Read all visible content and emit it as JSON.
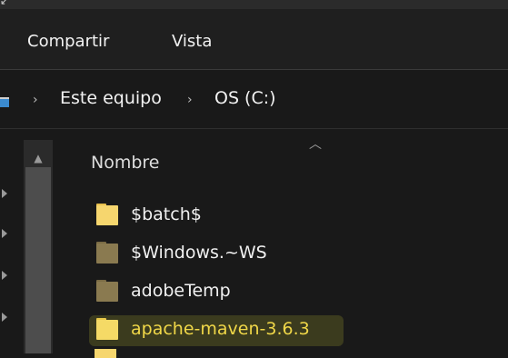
{
  "ribbon": {
    "tabs": [
      "Compartir",
      "Vista"
    ]
  },
  "address": {
    "crumbs": [
      "Este equipo",
      "OS (C:)"
    ],
    "separator": "›"
  },
  "columns": {
    "name_header": "Nombre"
  },
  "files": [
    {
      "name": "$batch$",
      "icon": "folder-icon",
      "dim": false
    },
    {
      "name": "$Windows.~WS",
      "icon": "folder-icon",
      "dim": true
    },
    {
      "name": "adobeTemp",
      "icon": "folder-icon",
      "dim": true
    },
    {
      "name": "apache-maven-3.6.3",
      "icon": "folder-icon",
      "dim": false,
      "selected": true
    }
  ],
  "colors": {
    "background": "#191919",
    "folder": "#f6d66e",
    "folder_dim": "#8a7a50",
    "highlight_text": "#f0d24a"
  }
}
